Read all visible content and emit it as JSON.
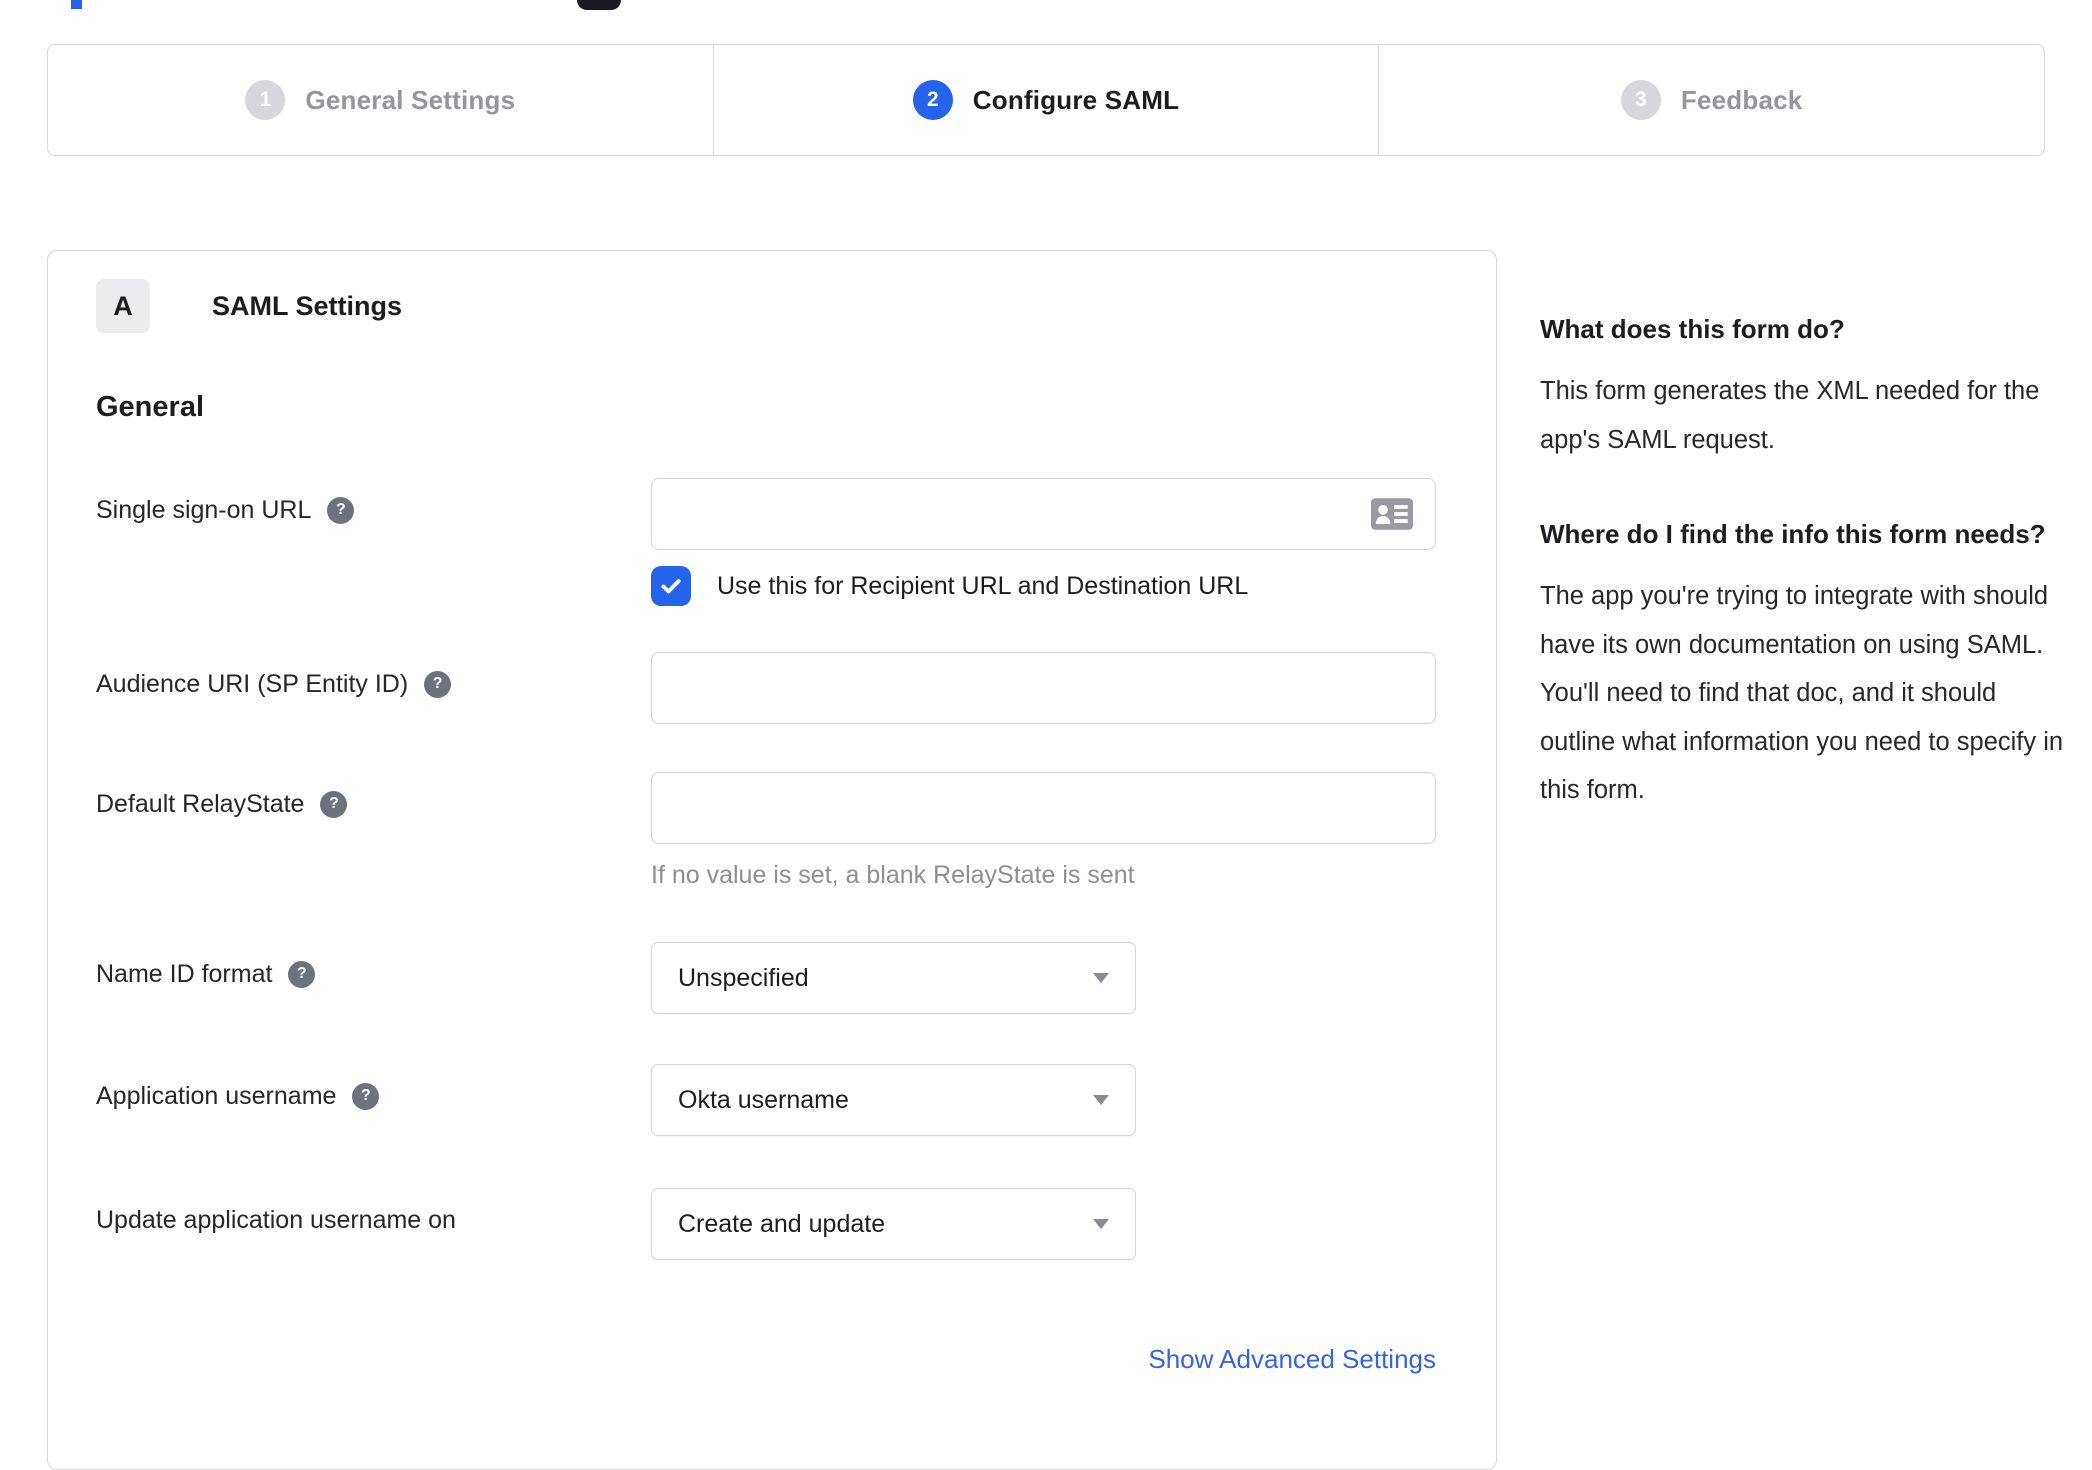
{
  "stepper": {
    "steps": [
      {
        "number": "1",
        "label": "General Settings",
        "state": "inactive"
      },
      {
        "number": "2",
        "label": "Configure SAML",
        "state": "active"
      },
      {
        "number": "3",
        "label": "Feedback",
        "state": "inactive"
      }
    ]
  },
  "panel": {
    "badge": "A",
    "title": "SAML Settings",
    "section_heading": "General",
    "rows": [
      {
        "label": "Single sign-on URL",
        "value": "",
        "checkbox_label": "Use this for Recipient URL and Destination URL",
        "checkbox_checked": true
      },
      {
        "label": "Audience URI (SP Entity ID)",
        "value": ""
      },
      {
        "label": "Default RelayState",
        "value": "",
        "hint": "If no value is set, a blank RelayState is sent"
      },
      {
        "label": "Name ID format",
        "value": "Unspecified"
      },
      {
        "label": "Application username",
        "value": "Okta username"
      },
      {
        "label": "Update application username on",
        "value": "Create and update"
      }
    ],
    "advanced_link": "Show Advanced Settings"
  },
  "sidebar": {
    "sections": [
      {
        "heading": "What does this form do?",
        "body": "This form generates the XML needed for the app's SAML request."
      },
      {
        "heading": "Where do I find the info this form needs?",
        "body": "The app you're trying to integrate with should have its own documentation on using SAML. You'll need to find that doc, and it should outline what information you need to specify in this form."
      }
    ]
  },
  "icons": {
    "help": "?"
  },
  "colors": {
    "accent_blue": "#2563eb",
    "link_blue": "#3464e4",
    "inactive_gray": "#9396a0",
    "border_gray": "#d6d6db",
    "text_dark": "#1d1d21",
    "hint_gray": "#8e8e96",
    "help_icon_gray": "#6e727c"
  }
}
